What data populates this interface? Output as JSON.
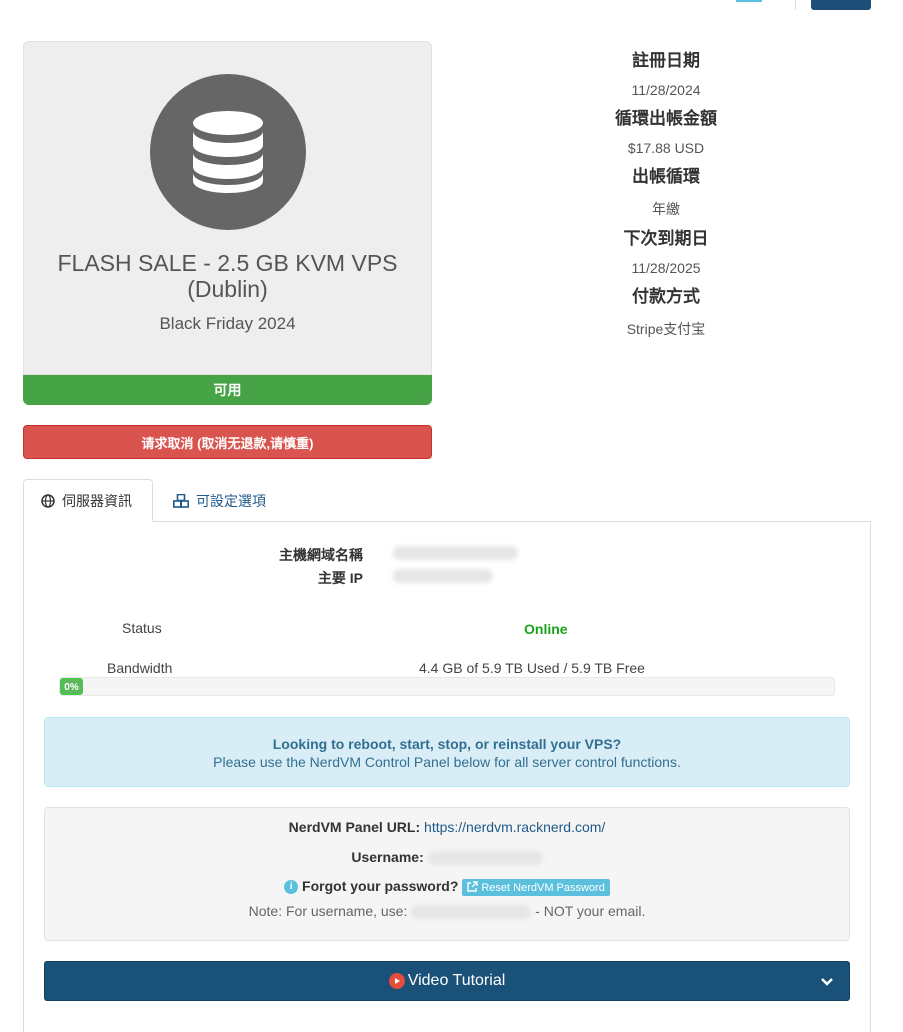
{
  "product": {
    "name": "FLASH SALE - 2.5 GB KVM VPS (Dublin)",
    "group": "Black Friday 2024",
    "status": "可用",
    "cancel_label": "请求取消 (取消无退款,请慎重)",
    "icon": "database-icon"
  },
  "details": {
    "reg_date_label": "註冊日期",
    "reg_date": "11/28/2024",
    "recurring_label": "循環出帳金額",
    "recurring": "$17.88 USD",
    "cycle_label": "出帳循環",
    "cycle": "年繳",
    "due_label": "下次到期日",
    "due": "11/28/2025",
    "payment_label": "付款方式",
    "payment": "Stripe支付宝"
  },
  "tabs": {
    "server_info": "伺服器資訊",
    "config": "可設定選項"
  },
  "server": {
    "hostname_label": "主機網域名稱",
    "ip_label": "主要 IP",
    "status_label": "Status",
    "status_value": "Online",
    "bandwidth_label": "Bandwidth",
    "bandwidth_value": "4.4 GB of 5.9 TB Used / 5.9 TB Free",
    "bandwidth_percent": "0%",
    "bandwidth_fraction": 0
  },
  "alert": {
    "title": "Looking to reboot, start, stop, or reinstall your VPS?",
    "body": "Please use the NerdVM Control Panel below for all server control functions."
  },
  "panel": {
    "url_label": "NerdVM Panel URL:",
    "url": "https://nerdvm.racknerd.com/",
    "username_label": "Username:",
    "forgot_label": "Forgot your password?",
    "reset_label": "Reset NerdVM Password",
    "note_prefix": "Note: For username, use:",
    "note_suffix": "- NOT your email."
  },
  "video": {
    "label": "Video Tutorial"
  },
  "colors": {
    "success": "#46a346",
    "danger": "#d9534f",
    "info_bg": "#d9edf7",
    "primary_dark": "#1a5178"
  }
}
